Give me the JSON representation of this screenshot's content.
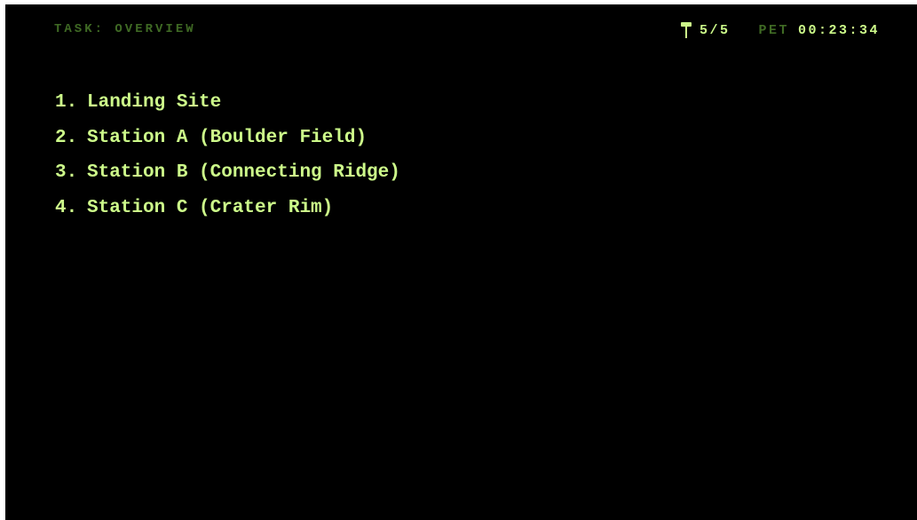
{
  "header": {
    "task_label": "TASK: OVERVIEW",
    "samples_icon": "flag-icon",
    "samples_value": "5/5",
    "pet_label": "PET",
    "pet_value": "00:23:34"
  },
  "stations": [
    {
      "number": "1.",
      "label": "Landing Site"
    },
    {
      "number": "2.",
      "label": "Station A (Boulder Field)"
    },
    {
      "number": "3.",
      "label": "Station B (Connecting Ridge)"
    },
    {
      "number": "4.",
      "label": "Station C (Crater Rim)"
    }
  ],
  "colors": {
    "background": "#000000",
    "primary_text": "#cdfb8a",
    "dim_text": "#3f6a24"
  }
}
